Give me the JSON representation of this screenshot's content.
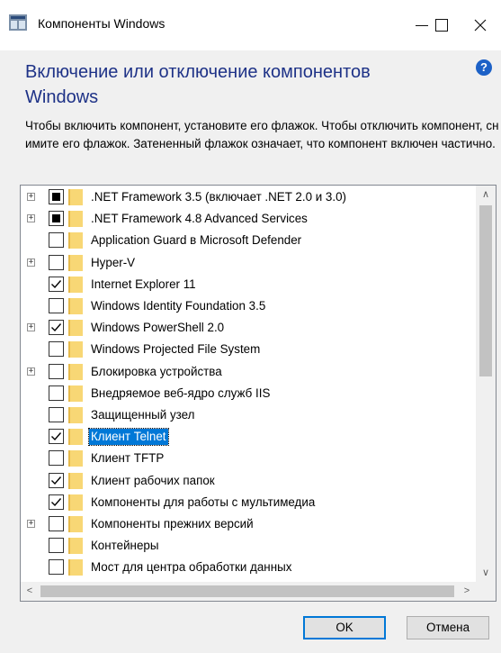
{
  "window": {
    "title": "Компоненты Windows",
    "icon": "windows-features-icon"
  },
  "heading": "Включение или отключение компонентов Windows",
  "description": "Чтобы включить компонент, установите его флажок. Чтобы отключить компонент, снимите его флажок. Затененный флажок означает, что компонент включен частично.",
  "help_icon_text": "?",
  "features": [
    {
      "label": ".NET Framework 3.5 (включает .NET 2.0 и 3.0)",
      "expandable": true,
      "state": "partial"
    },
    {
      "label": ".NET Framework 4.8 Advanced Services",
      "expandable": true,
      "state": "partial"
    },
    {
      "label": "Application Guard в Microsoft Defender",
      "expandable": false,
      "state": "unchecked"
    },
    {
      "label": "Hyper-V",
      "expandable": true,
      "state": "unchecked"
    },
    {
      "label": "Internet Explorer 11",
      "expandable": false,
      "state": "checked"
    },
    {
      "label": "Windows Identity Foundation 3.5",
      "expandable": false,
      "state": "unchecked"
    },
    {
      "label": "Windows PowerShell 2.0",
      "expandable": true,
      "state": "checked"
    },
    {
      "label": "Windows Projected File System",
      "expandable": false,
      "state": "unchecked"
    },
    {
      "label": "Блокировка устройства",
      "expandable": true,
      "state": "unchecked"
    },
    {
      "label": "Внедряемое веб-ядро служб IIS",
      "expandable": false,
      "state": "unchecked"
    },
    {
      "label": "Защищенный узел",
      "expandable": false,
      "state": "unchecked"
    },
    {
      "label": "Клиент Telnet",
      "expandable": false,
      "state": "checked",
      "selected": true
    },
    {
      "label": "Клиент TFTP",
      "expandable": false,
      "state": "unchecked"
    },
    {
      "label": "Клиент рабочих папок",
      "expandable": false,
      "state": "checked"
    },
    {
      "label": "Компоненты для работы с мультимедиа",
      "expandable": false,
      "state": "checked"
    },
    {
      "label": "Компоненты прежних версий",
      "expandable": true,
      "state": "unchecked"
    },
    {
      "label": "Контейнеры",
      "expandable": false,
      "state": "unchecked"
    },
    {
      "label": "Мост для центра обработки данных",
      "expandable": false,
      "state": "unchecked"
    }
  ],
  "buttons": {
    "ok": "OK",
    "cancel": "Отмена"
  },
  "colors": {
    "heading": "#1e3287",
    "selection": "#0078d7",
    "folder": "#f8d775"
  }
}
